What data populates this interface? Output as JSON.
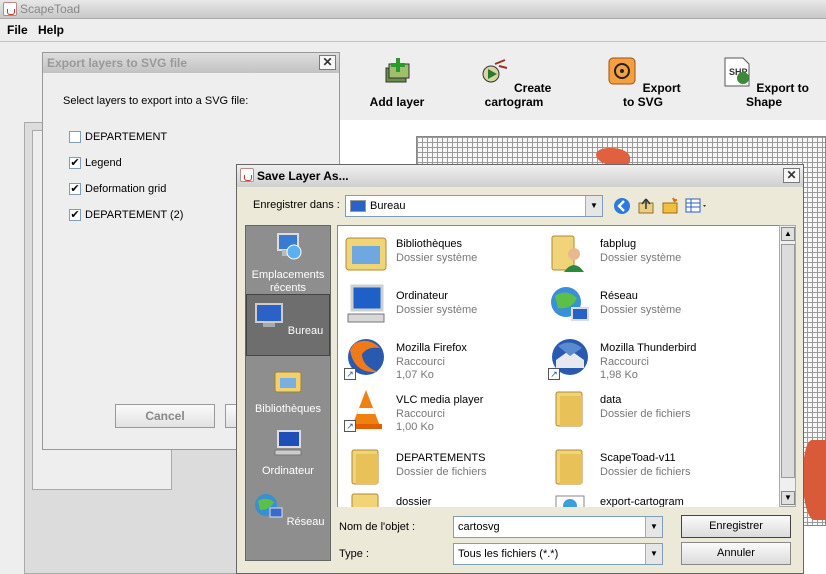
{
  "app": {
    "title": "ScapeToad"
  },
  "menu": {
    "file": "File",
    "help": "Help"
  },
  "toolbar": {
    "add_layer": "Add layer",
    "create_cartogram": "Create cartogram",
    "export_svg": "Export to SVG",
    "export_shape": "Export to Shape"
  },
  "export_dialog": {
    "title": "Export layers to SVG file",
    "prompt": "Select layers to export into a SVG file:",
    "layers": [
      {
        "label": "DEPARTEMENT",
        "checked": false
      },
      {
        "label": "Legend",
        "checked": true
      },
      {
        "label": "Deformation grid",
        "checked": true
      },
      {
        "label": "DEPARTEMENT (2)",
        "checked": true
      }
    ],
    "cancel": "Cancel"
  },
  "save_dialog": {
    "title": "Save Layer As...",
    "look_in_label": "Enregistrer dans :",
    "look_in_value": "Bureau",
    "places": [
      {
        "label": "Emplacements récents",
        "icon": "recent-places-icon"
      },
      {
        "label": "Bureau",
        "icon": "desktop-icon",
        "selected": true
      },
      {
        "label": "Bibliothèques",
        "icon": "libraries-icon"
      },
      {
        "label": "Ordinateur",
        "icon": "computer-icon"
      },
      {
        "label": "Réseau",
        "icon": "network-icon"
      }
    ],
    "files": [
      {
        "name": "Bibliothèques",
        "type": "Dossier système",
        "size": ""
      },
      {
        "name": "fabplug",
        "type": "Dossier système",
        "size": ""
      },
      {
        "name": "Ordinateur",
        "type": "Dossier système",
        "size": ""
      },
      {
        "name": "Réseau",
        "type": "Dossier système",
        "size": ""
      },
      {
        "name": "Mozilla Firefox",
        "type": "Raccourci",
        "size": "1,07 Ko"
      },
      {
        "name": "Mozilla Thunderbird",
        "type": "Raccourci",
        "size": "1,98 Ko"
      },
      {
        "name": "VLC media player",
        "type": "Raccourci",
        "size": "1,00 Ko"
      },
      {
        "name": "data",
        "type": "Dossier de fichiers",
        "size": ""
      },
      {
        "name": "DEPARTEMENTS",
        "type": "Dossier de fichiers",
        "size": ""
      },
      {
        "name": "ScapeToad-v11",
        "type": "Dossier de fichiers",
        "size": ""
      },
      {
        "name": "dossier",
        "type": "",
        "size": ""
      },
      {
        "name": "export-cartogram",
        "type": "",
        "size": ""
      }
    ],
    "filename_label": "Nom de l'objet :",
    "filename_value": "cartosvg",
    "type_label": "Type :",
    "type_value": "Tous les fichiers (*.*)",
    "save_button": "Enregistrer",
    "cancel_button": "Annuler"
  }
}
